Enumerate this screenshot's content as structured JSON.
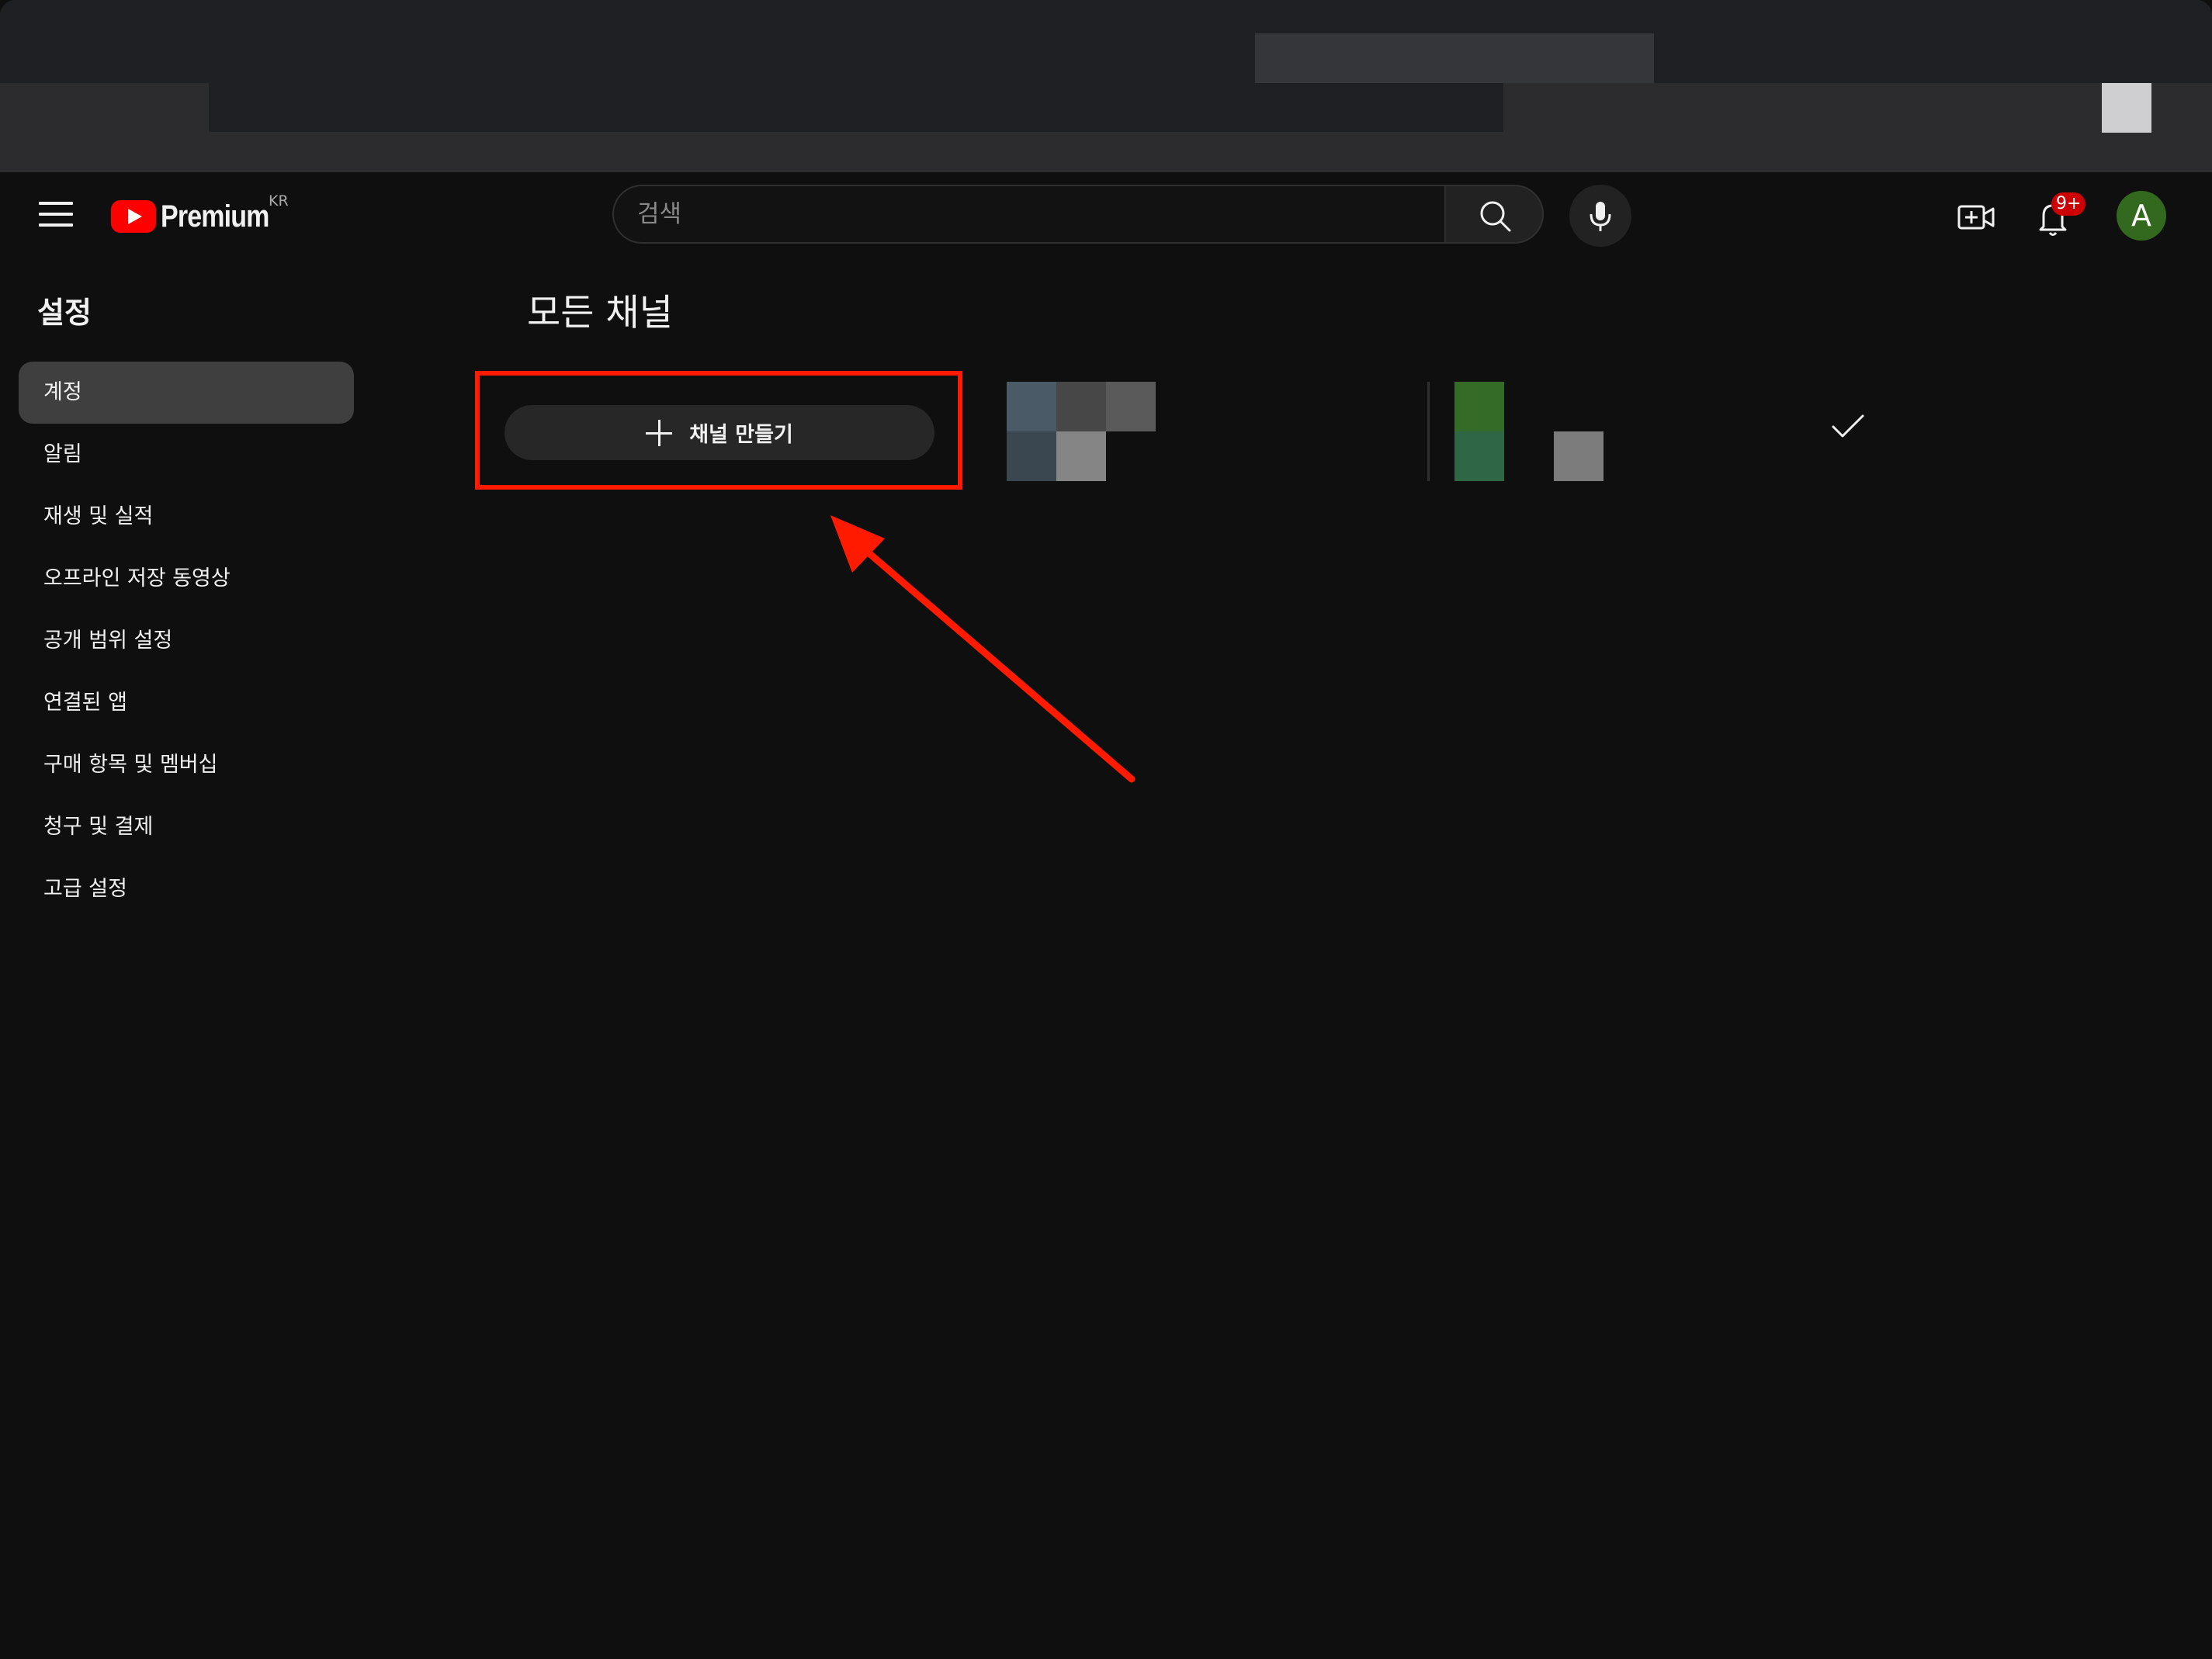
{
  "header": {
    "logo_text": "Premium",
    "country_code": "KR",
    "search_placeholder": "검색",
    "notification_count": "9+",
    "avatar_initial": "A",
    "colors": {
      "brand_red": "#ff0000",
      "badge": "#cc0000",
      "avatar": "#33691e"
    },
    "icons": [
      "hamburger-menu-icon",
      "youtube-logo-icon",
      "search-icon",
      "microphone-icon",
      "create-video-icon",
      "bell-icon"
    ]
  },
  "sidebar": {
    "title": "설정",
    "items": [
      {
        "label": "계정",
        "active": true
      },
      {
        "label": "알림"
      },
      {
        "label": "재생 및 실적"
      },
      {
        "label": "오프라인 저장 동영상"
      },
      {
        "label": "공개 범위 설정"
      },
      {
        "label": "연결된 앱"
      },
      {
        "label": "구매 항목 및 멤버십"
      },
      {
        "label": "청구 및 결제"
      },
      {
        "label": "고급 설정"
      }
    ]
  },
  "main": {
    "title": "모든 채널",
    "create_channel_label": "채널 만들기",
    "annotation_color": "#ff1a00"
  }
}
